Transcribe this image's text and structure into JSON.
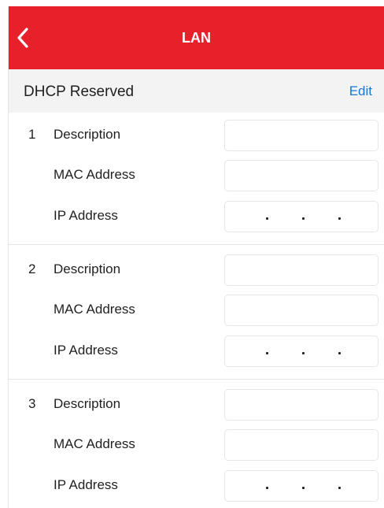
{
  "header": {
    "title": "LAN"
  },
  "section": {
    "title": "DHCP Reserved",
    "edit_label": "Edit"
  },
  "entries": [
    {
      "index": "1",
      "fields": [
        {
          "label": "Description",
          "value": ""
        },
        {
          "label": "MAC Address",
          "value": ""
        },
        {
          "label": "IP Address",
          "value": ""
        }
      ]
    },
    {
      "index": "2",
      "fields": [
        {
          "label": "Description",
          "value": ""
        },
        {
          "label": "MAC Address",
          "value": ""
        },
        {
          "label": "IP Address",
          "value": ""
        }
      ]
    },
    {
      "index": "3",
      "fields": [
        {
          "label": "Description",
          "value": ""
        },
        {
          "label": "MAC Address",
          "value": ""
        },
        {
          "label": "IP Address",
          "value": ""
        }
      ]
    }
  ],
  "colors": {
    "header_bg": "#e8202a",
    "accent": "#1976d2"
  }
}
